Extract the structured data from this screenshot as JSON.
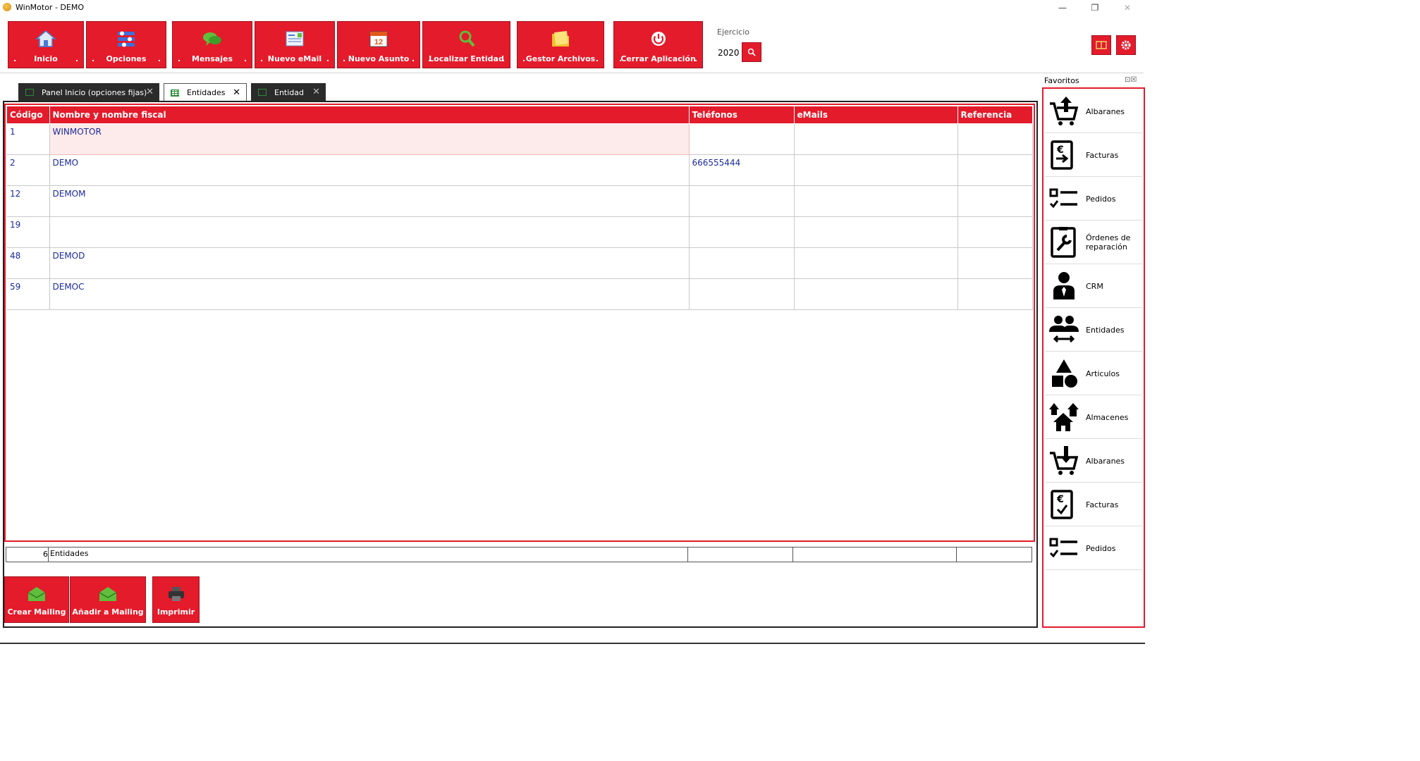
{
  "window": {
    "title": "WinMotor - DEMO",
    "minimize": "—",
    "restore": "❐",
    "close": "✕"
  },
  "ribbon": {
    "buttons": [
      {
        "label": "Inicio",
        "icon": "home-icon"
      },
      {
        "label": "Opciones",
        "icon": "options-icon"
      },
      {
        "label": "Mensajes",
        "icon": "chat-icon"
      },
      {
        "label": "Nuevo eMail",
        "icon": "email-icon"
      },
      {
        "label": "Nuevo Asunto",
        "icon": "calendar-icon"
      },
      {
        "label": "Localizar Entidad",
        "icon": "search-icon"
      },
      {
        "label": "Gestor Archivos",
        "icon": "folder-icon"
      },
      {
        "label": "Cerrar Aplicación",
        "icon": "power-icon"
      }
    ],
    "dot": ".",
    "ejercicio_label": "Ejercicio",
    "ejercicio_year": "2020"
  },
  "tabs": [
    {
      "label": "Panel Inicio (opciones fijas)"
    },
    {
      "label": "Entidades"
    },
    {
      "label": "Entidad"
    }
  ],
  "tab_close": "✕",
  "grid": {
    "columns": [
      "Código",
      "Nombre y nombre fiscal",
      "Teléfonos",
      "eMails",
      "Referencia"
    ],
    "rows": [
      {
        "codigo": "1",
        "nombre": "WINMOTOR",
        "telefonos": "",
        "emails": "",
        "referencia": ""
      },
      {
        "codigo": "2",
        "nombre": "DEMO",
        "telefonos": "666555444",
        "emails": "",
        "referencia": ""
      },
      {
        "codigo": "12",
        "nombre": "DEMOM",
        "telefonos": "",
        "emails": "",
        "referencia": ""
      },
      {
        "codigo": "19",
        "nombre": "",
        "telefonos": "",
        "emails": "",
        "referencia": ""
      },
      {
        "codigo": "48",
        "nombre": "DEMOD",
        "telefonos": "",
        "emails": "",
        "referencia": ""
      },
      {
        "codigo": "59",
        "nombre": "DEMOC",
        "telefonos": "",
        "emails": "",
        "referencia": ""
      }
    ],
    "summary_count": "6",
    "summary_label": "Entidades"
  },
  "actions": [
    {
      "label": "Crear Mailing",
      "icon": "mail-open-icon"
    },
    {
      "label": "Añadir a Mailing",
      "icon": "mail-add-icon"
    },
    {
      "label": "Imprimir",
      "icon": "printer-icon"
    }
  ],
  "favorites": {
    "title": "Favoritos",
    "controls": "⊡☒",
    "items": [
      {
        "label": "Albaranes",
        "icon": "cart-upload-icon"
      },
      {
        "label": "Facturas",
        "icon": "invoice-out-icon"
      },
      {
        "label": "Pedidos",
        "icon": "checklist-icon"
      },
      {
        "label": "Órdenes de reparación",
        "icon": "wrench-doc-icon"
      },
      {
        "label": "CRM",
        "icon": "person-icon"
      },
      {
        "label": "Entidades",
        "icon": "people-arrows-icon"
      },
      {
        "label": "Articulos",
        "icon": "shapes-icon"
      },
      {
        "label": "Almacenes",
        "icon": "houses-icon"
      },
      {
        "label": "Albaranes",
        "icon": "cart-download-icon"
      },
      {
        "label": "Facturas",
        "icon": "invoice-check-icon"
      },
      {
        "label": "Pedidos",
        "icon": "checklist-icon"
      }
    ]
  },
  "colors": {
    "accent": "#e31b2b",
    "row_text": "#1a2a9c",
    "selected_row": "#fdeaea"
  }
}
